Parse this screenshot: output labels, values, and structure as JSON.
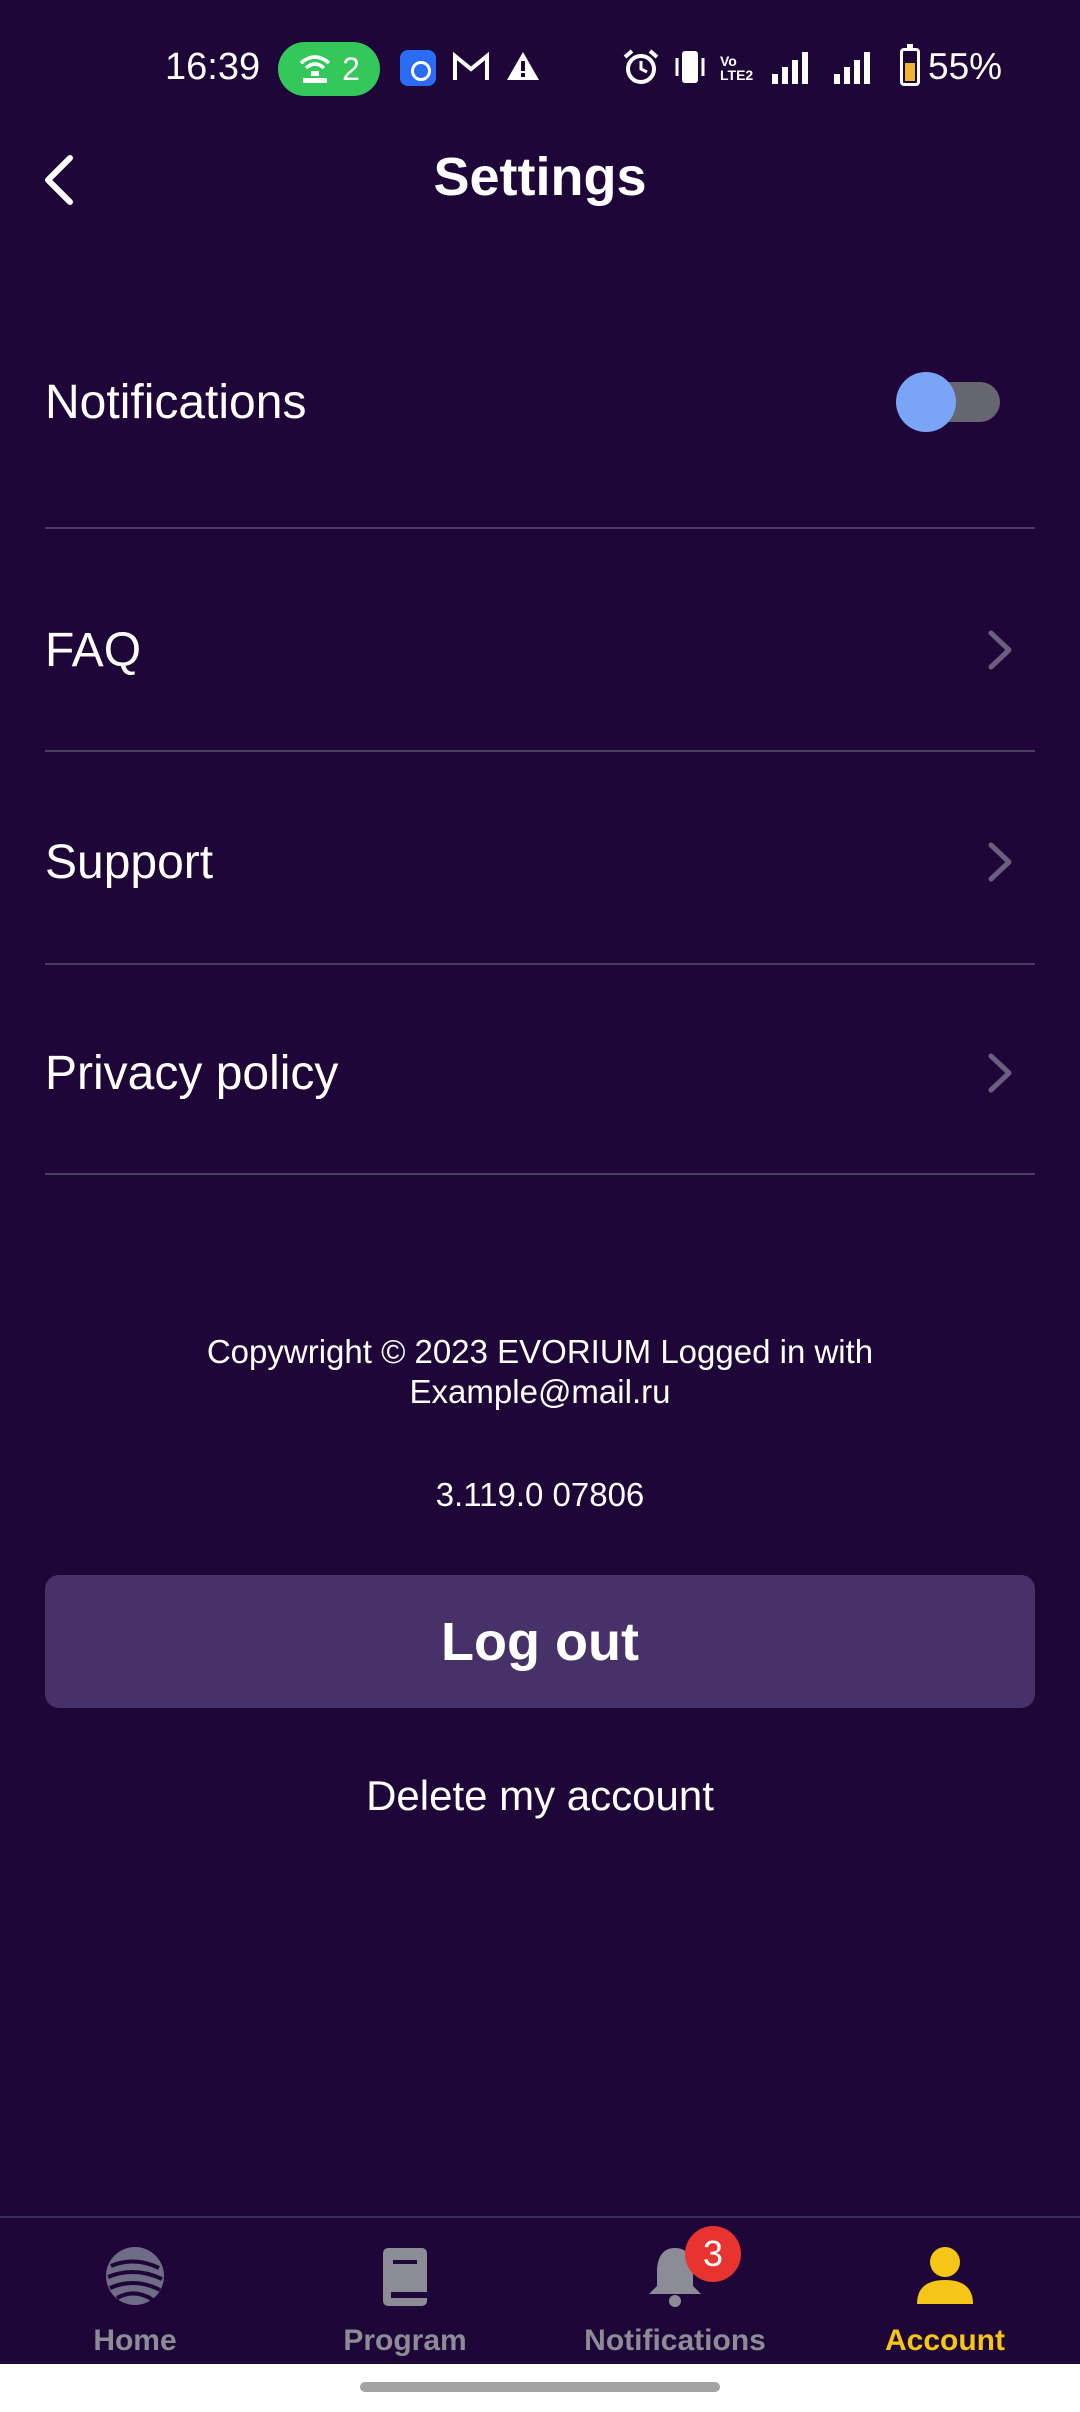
{
  "status_bar": {
    "time": "16:39",
    "hotspot_count": "2",
    "battery_percent": "55%",
    "icons": [
      "hotspot-icon",
      "app-icon",
      "gmail-icon",
      "warning-icon",
      "alarm-icon",
      "vibrate-icon",
      "volte-icon",
      "signal-icon",
      "signal-4g-icon",
      "battery-icon"
    ]
  },
  "header": {
    "title": "Settings"
  },
  "settings": {
    "notifications_label": "Notifications",
    "notifications_enabled": true,
    "faq_label": "FAQ",
    "support_label": "Support",
    "privacy_label": "Privacy policy"
  },
  "footer": {
    "copyright_line1": "Copywright © 2023 EVORIUM Logged in with",
    "copyright_line2": "Example@mail.ru",
    "version": "3.119.0 07806"
  },
  "actions": {
    "logout_label": "Log out",
    "delete_label": "Delete my account"
  },
  "bottom_nav": {
    "items": [
      {
        "label": "Home",
        "icon": "globe-icon",
        "active": false
      },
      {
        "label": "Program",
        "icon": "book-icon",
        "active": false
      },
      {
        "label": "Notifications",
        "icon": "bell-icon",
        "active": false,
        "badge": "3"
      },
      {
        "label": "Account",
        "icon": "person-icon",
        "active": true
      }
    ]
  },
  "colors": {
    "background": "#1f0638",
    "button": "#463169",
    "accent": "#f5c518",
    "toggle_knob": "#7aa4f5",
    "badge": "#e8332f"
  }
}
